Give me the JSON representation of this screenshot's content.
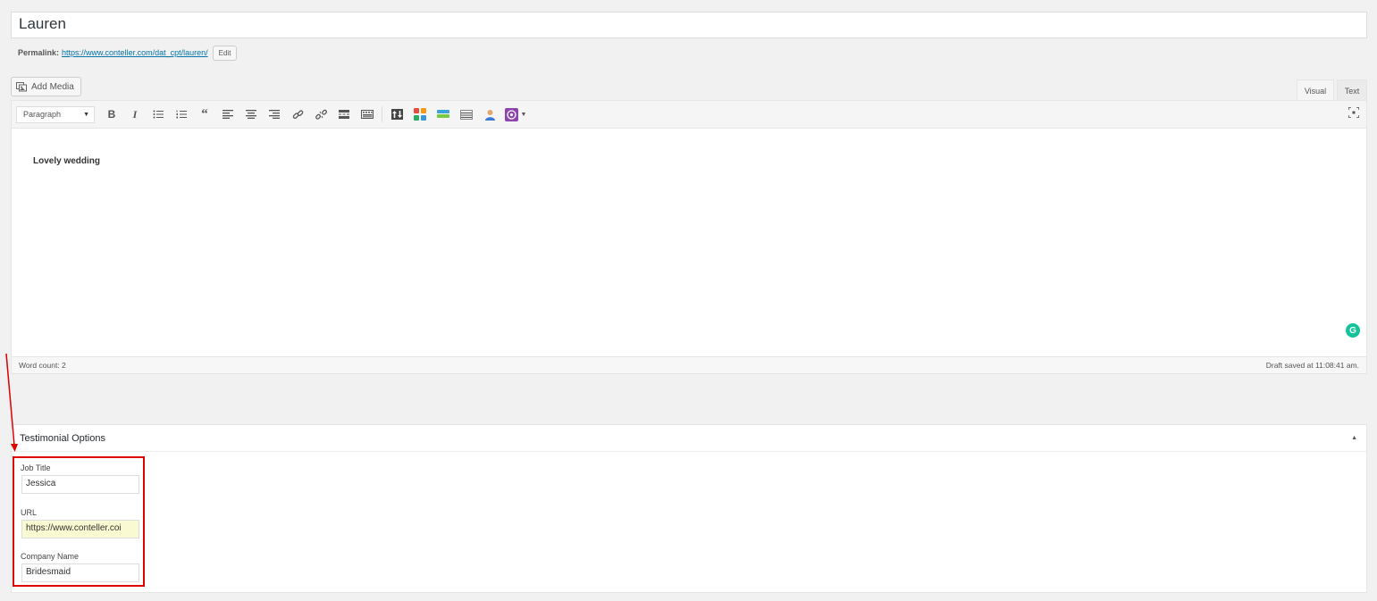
{
  "post": {
    "title": "Lauren",
    "permalink_label": "Permalink:",
    "permalink_url": "https://www.conteller.com/dat_cpt/lauren/",
    "edit_label": "Edit"
  },
  "media": {
    "add_media_label": "Add Media"
  },
  "editor_tabs": {
    "visual": "Visual",
    "text": "Text"
  },
  "toolbar": {
    "format_select": "Paragraph",
    "buttons": [
      "bold",
      "italic",
      "bulleted-list",
      "numbered-list",
      "blockquote",
      "align-left",
      "align-center",
      "align-right",
      "insert-link",
      "remove-link",
      "read-more",
      "toolbar-toggle",
      "plugin-shortcode",
      "plugin-grid",
      "plugin-button",
      "plugin-table",
      "plugin-user",
      "plugin-dropdown",
      "fullscreen"
    ]
  },
  "content": {
    "text": "Lovely wedding"
  },
  "status": {
    "word_count": "Word count: 2",
    "draft_saved": "Draft saved at 11:08:41 am."
  },
  "metabox": {
    "title": "Testimonial Options",
    "fields": [
      {
        "label": "Job Title",
        "value": "Jessica"
      },
      {
        "label": "URL",
        "value": "https://www.conteller.coi"
      },
      {
        "label": "Company Name",
        "value": "Bridesmaid"
      }
    ]
  },
  "colors": {
    "annotation": "#e00000",
    "link": "#0073aa",
    "grammarly": "#15c39a"
  }
}
